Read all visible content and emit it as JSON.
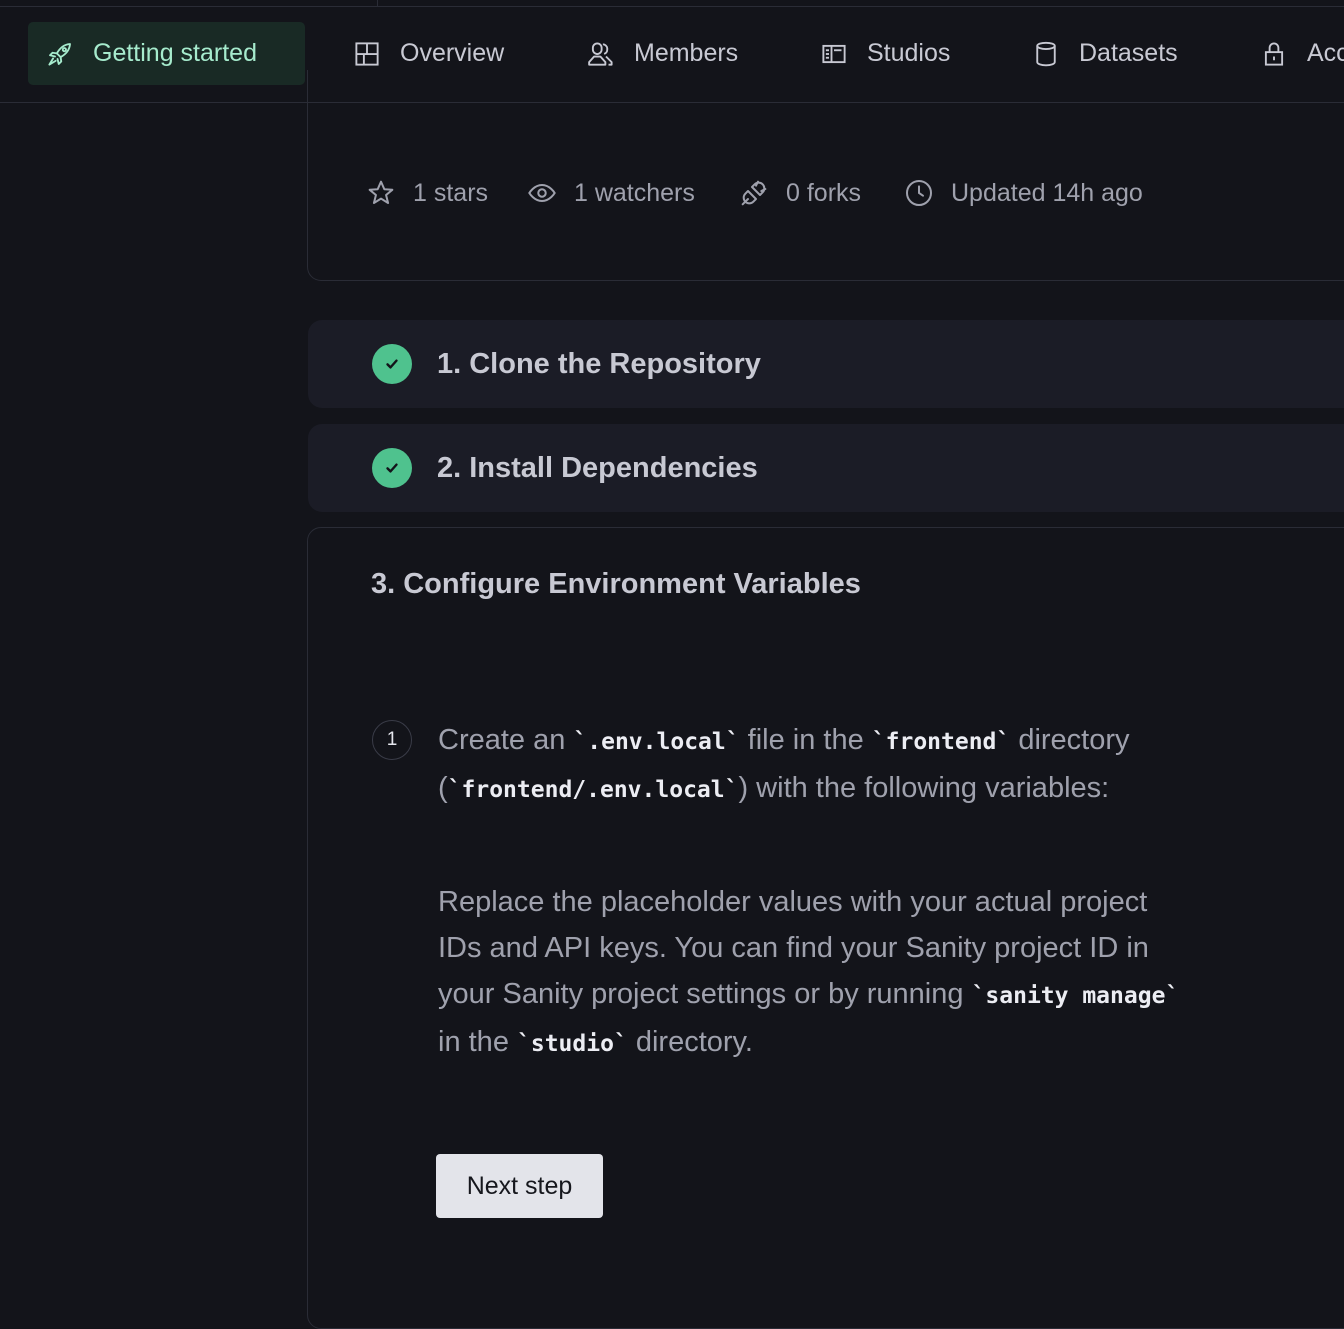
{
  "tabs": [
    {
      "label": "Getting started",
      "icon": "rocket-icon",
      "active": true
    },
    {
      "label": "Overview",
      "icon": "layout-icon"
    },
    {
      "label": "Members",
      "icon": "users-icon"
    },
    {
      "label": "Studios",
      "icon": "studio-icon"
    },
    {
      "label": "Datasets",
      "icon": "database-icon"
    },
    {
      "label": "Acc",
      "icon": "lock-icon"
    }
  ],
  "repo": {
    "stars": "1 stars",
    "watchers": "1 watchers",
    "forks": "0 forks",
    "updated": "Updated 14h ago"
  },
  "steps": [
    {
      "title": "1. Clone the Repository",
      "completed": true
    },
    {
      "title": "2. Install Dependencies",
      "completed": true
    },
    {
      "title": "3. Configure Environment Variables",
      "completed": false
    }
  ],
  "substep": {
    "number": "1",
    "p1": {
      "t1": "Create an ",
      "c1": "`.env.local`",
      "t2": " file in the ",
      "c2": "`frontend`",
      "t3": " directory (",
      "c3": "`frontend/.env.local`",
      "t4": ") with the following variables:"
    },
    "p2": {
      "t1": "Replace the placeholder values with your actual project IDs and API keys. You can find your Sanity project ID in your Sanity project settings or by running ",
      "c1": "`sanity manage`",
      "t2": " in the ",
      "c2": "`studio`",
      "t3": " directory."
    }
  },
  "next_button": "Next step",
  "colors": {
    "background": "#13141a",
    "accent": "#4fc28e",
    "active_tab_bg": "#192a25",
    "active_tab_text": "#a6ebcd"
  }
}
